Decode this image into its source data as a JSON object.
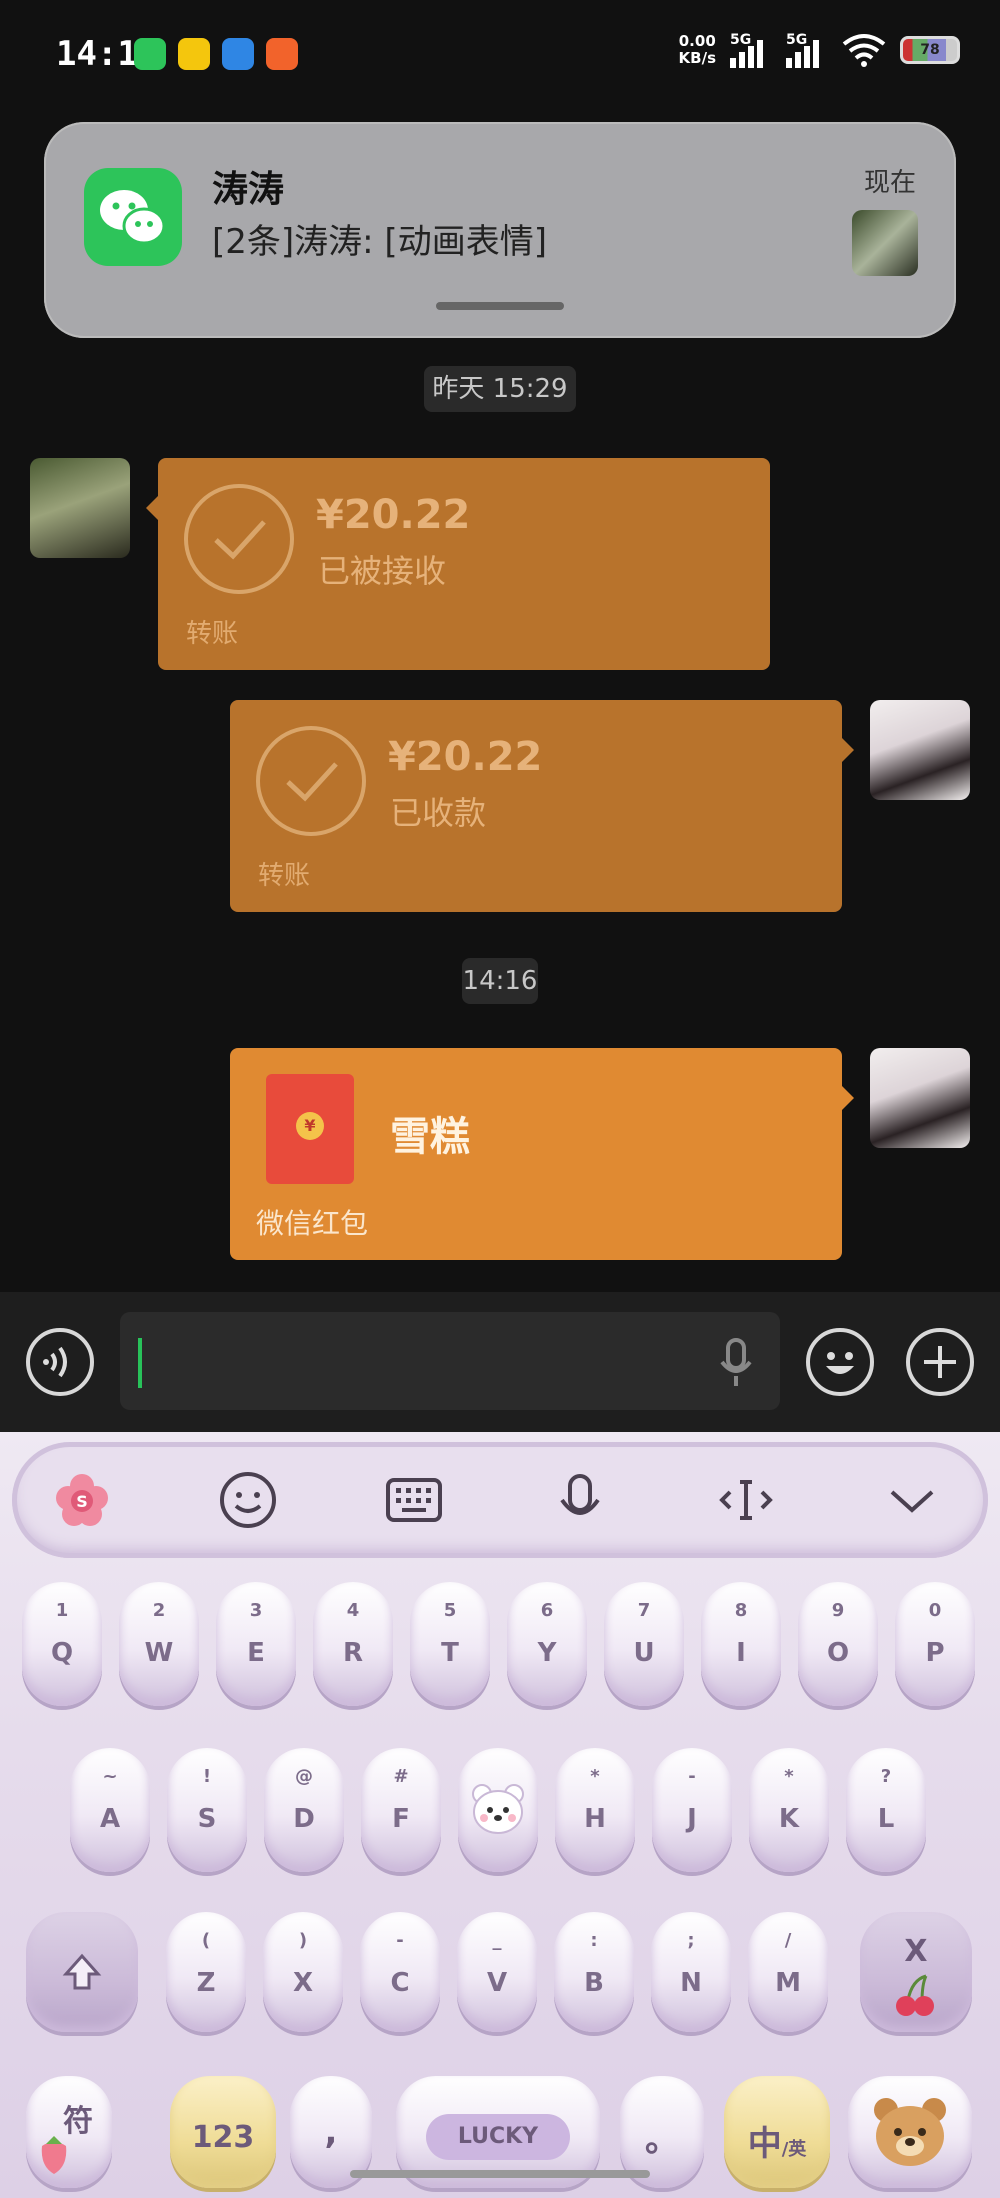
{
  "status_bar": {
    "time": "14:17",
    "net_speed_value": "0.00",
    "net_speed_unit": "KB/s",
    "signal1": "5G",
    "signal2": "5G",
    "battery": "78"
  },
  "notification": {
    "title": "涛涛",
    "body": "[2条]涛涛: [动画表情]",
    "time": "现在"
  },
  "chat": {
    "time_1": "昨天 15:29",
    "time_2": "14:16",
    "messages": [
      {
        "side": "left",
        "type": "transfer",
        "amount": "¥20.22",
        "status": "已被接收",
        "footer": "转账"
      },
      {
        "side": "right",
        "type": "transfer",
        "amount": "¥20.22",
        "status": "已收款",
        "footer": "转账"
      },
      {
        "side": "right",
        "type": "red_packet",
        "title": "雪糕",
        "footer": "微信红包",
        "coin": "¥"
      }
    ]
  },
  "keyboard": {
    "toolbar": [
      "flower-s-icon",
      "emoji-icon",
      "keyboard-icon",
      "mic-icon",
      "cursor-icon",
      "collapse-icon"
    ],
    "toolbar_badge": "S",
    "row1": [
      {
        "num": "1",
        "letter": "Q"
      },
      {
        "num": "2",
        "letter": "W"
      },
      {
        "num": "3",
        "letter": "E"
      },
      {
        "num": "4",
        "letter": "R"
      },
      {
        "num": "5",
        "letter": "T"
      },
      {
        "num": "6",
        "letter": "Y"
      },
      {
        "num": "7",
        "letter": "U"
      },
      {
        "num": "8",
        "letter": "I"
      },
      {
        "num": "9",
        "letter": "O"
      },
      {
        "num": "0",
        "letter": "P"
      }
    ],
    "row2": [
      {
        "num": "~",
        "letter": "A"
      },
      {
        "num": "!",
        "letter": "S"
      },
      {
        "num": "@",
        "letter": "D"
      },
      {
        "num": "#",
        "letter": "F"
      },
      {
        "num": "",
        "letter": ""
      },
      {
        "num": "*",
        "letter": "H"
      },
      {
        "num": "-",
        "letter": "J"
      },
      {
        "num": "*",
        "letter": "K"
      },
      {
        "num": "?",
        "letter": "L"
      }
    ],
    "row3": [
      {
        "num": "(",
        "letter": "Z"
      },
      {
        "num": ")",
        "letter": "X"
      },
      {
        "num": "-",
        "letter": "C"
      },
      {
        "num": "_",
        "letter": "V"
      },
      {
        "num": ":",
        "letter": "B"
      },
      {
        "num": ";",
        "letter": "N"
      },
      {
        "num": "/",
        "letter": "M"
      }
    ],
    "row4": {
      "symbols": "符",
      "numbers": "123",
      "comma": ",",
      "space": "LUCKY",
      "period": "。",
      "lang_main": "中",
      "lang_alt": "/英"
    },
    "delete": "X"
  }
}
